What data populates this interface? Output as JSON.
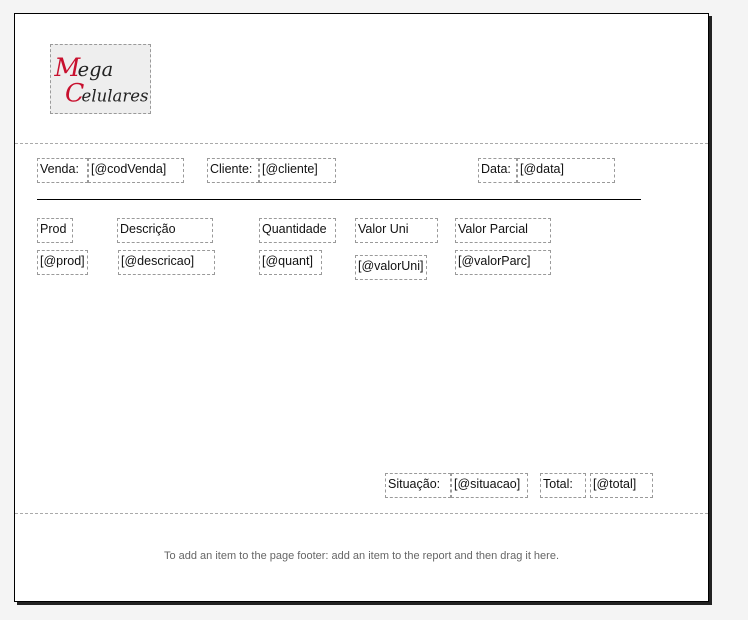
{
  "logo": {
    "line1": "Mega",
    "line2": "Celulares"
  },
  "header_fields": {
    "venda_label": "Venda:",
    "venda_value": "[@codVenda]",
    "cliente_label": "Cliente:",
    "cliente_value": "[@cliente]",
    "data_label": "Data:",
    "data_value": "[@data]"
  },
  "columns": {
    "headers": [
      "Prod",
      "Descrição",
      "Quantidade",
      "Valor Uni",
      "Valor Parcial"
    ],
    "values": [
      "[@prod]",
      "[@descricao]",
      "[@quant]",
      "[@valorUni]",
      "[@valorParc]"
    ]
  },
  "totals": {
    "situacao_label": "Situação:",
    "situacao_value": "[@situacao]",
    "total_label": "Total:",
    "total_value": "[@total]"
  },
  "footer": {
    "hint": "To add an item to the page footer: add an item to the report and then drag it here."
  }
}
